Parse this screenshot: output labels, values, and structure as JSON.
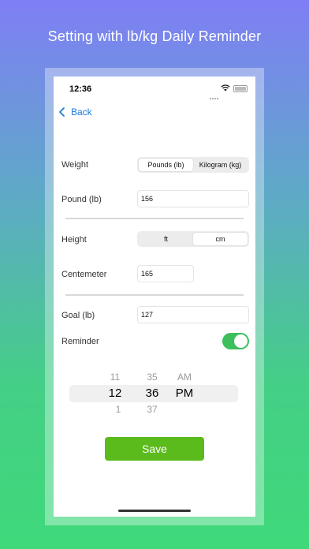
{
  "headline": "Setting with lb/kg Daily Reminder",
  "status_bar": {
    "time": "12:36"
  },
  "nav": {
    "back_label": "Back"
  },
  "weight": {
    "label": "Weight",
    "options": [
      "Pounds (lb)",
      "Kilogram (kg)"
    ],
    "selected": "Pounds (lb)"
  },
  "pound": {
    "label": "Pound (lb)",
    "value": "156"
  },
  "height": {
    "label": "Height",
    "options": [
      "ft",
      "cm"
    ],
    "selected": "cm"
  },
  "centimeter": {
    "label": "Centemeter",
    "value": "165"
  },
  "goal": {
    "label": "Goal (lb)",
    "value": "127"
  },
  "reminder": {
    "label": "Reminder",
    "enabled": true,
    "toggle_color": "#3cbf5c"
  },
  "time_picker": {
    "hour": {
      "prev": "11",
      "selected": "12",
      "next": "1"
    },
    "minute": {
      "prev": "35",
      "selected": "36",
      "next": "37"
    },
    "period": {
      "prev": "AM",
      "selected": "PM"
    }
  },
  "save_button": {
    "label": "Save",
    "color": "#5bba1c"
  }
}
